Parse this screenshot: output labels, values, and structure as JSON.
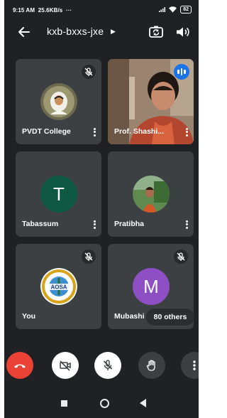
{
  "status_bar": {
    "time": "9:15 AM",
    "speed": "25.6KB/s",
    "more": "···",
    "battery": "82"
  },
  "meeting": {
    "code": "kxb-bxxs-jxe"
  },
  "participants": [
    {
      "name": "PVDT College",
      "mic_muted": true,
      "avatar": "photo"
    },
    {
      "name": "Prof. Shashi...",
      "mic_muted": false,
      "speaking": true,
      "avatar": "video"
    },
    {
      "name": "Tabassum",
      "mic_muted": false,
      "avatar": "letter",
      "letter": "T",
      "color": "#0f5943"
    },
    {
      "name": "Pratibha",
      "mic_muted": false,
      "avatar": "photo"
    },
    {
      "name": "You",
      "mic_muted": true,
      "avatar": "logo",
      "logo_text": "AOSA"
    },
    {
      "name": "Mubashi",
      "mic_muted": true,
      "avatar": "letter",
      "letter": "M",
      "color": "#8e4fc4"
    }
  ],
  "others": {
    "label": "80 others"
  },
  "controls": {
    "end_call_color": "#ea4335",
    "camera": "camera-off",
    "mic": "mic-off",
    "hand": "raise-hand",
    "more": "more-options"
  }
}
